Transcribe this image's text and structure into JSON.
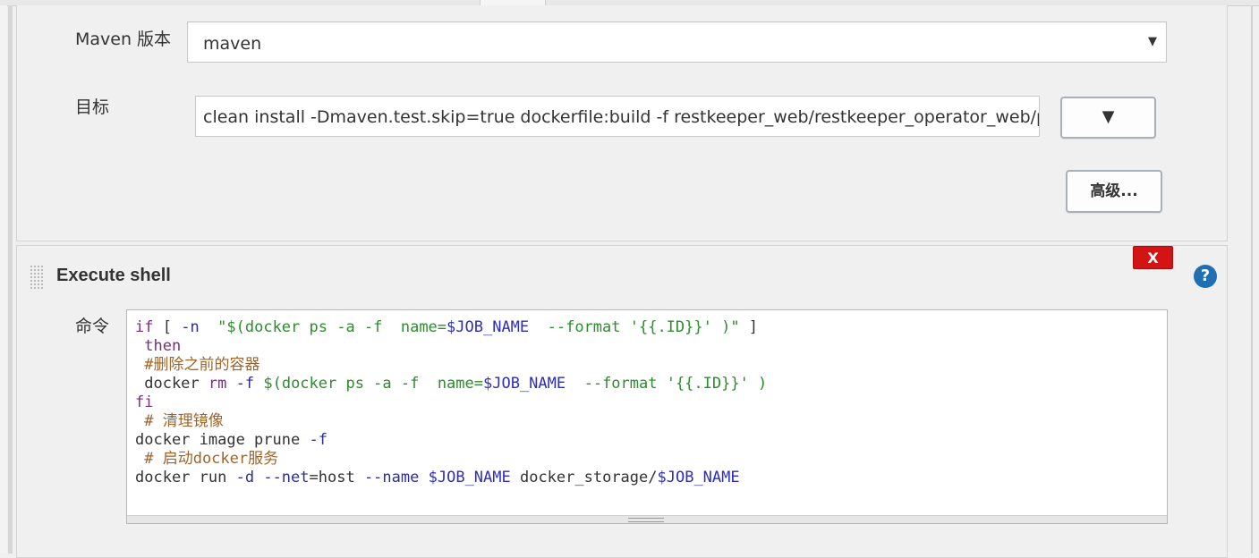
{
  "maven": {
    "version_label": "Maven 版本",
    "version_value": "maven",
    "goals_label": "目标",
    "goals_value": "clean install -Dmaven.test.skip=true dockerfile:build -f restkeeper_web/restkeeper_operator_web/pom.xml",
    "expand_glyph": "▼",
    "advanced_label": "高级..."
  },
  "shell": {
    "title": "Execute shell",
    "delete_label": "X",
    "help_glyph": "?",
    "command_label": "命令",
    "lines": [
      [
        {
          "t": "if",
          "c": "kw"
        },
        {
          "t": " [ ",
          "c": ""
        },
        {
          "t": "-n",
          "c": "opt"
        },
        {
          "t": "  \"$(docker ps -a -f  name=",
          "c": "str"
        },
        {
          "t": "$JOB_NAME",
          "c": "var"
        },
        {
          "t": "  --format '{{.ID}}' )\"",
          "c": "str"
        },
        {
          "t": " ]",
          "c": ""
        }
      ],
      [
        {
          "t": " then",
          "c": "kw"
        }
      ],
      [
        {
          "t": " #删除之前的容器",
          "c": "com"
        }
      ],
      [
        {
          "t": " docker ",
          "c": ""
        },
        {
          "t": "rm",
          "c": "kw"
        },
        {
          "t": " ",
          "c": ""
        },
        {
          "t": "-f",
          "c": "opt"
        },
        {
          "t": " ",
          "c": ""
        },
        {
          "t": "$(docker ps -a -f  name=",
          "c": "str"
        },
        {
          "t": "$JOB_NAME",
          "c": "var"
        },
        {
          "t": "  --format '{{.ID}}' )",
          "c": "str"
        }
      ],
      [
        {
          "t": "fi",
          "c": "kw"
        }
      ],
      [
        {
          "t": " # 清理镜像",
          "c": "com"
        }
      ],
      [
        {
          "t": "docker image prune ",
          "c": ""
        },
        {
          "t": "-f",
          "c": "opt"
        }
      ],
      [
        {
          "t": " # 启动docker服务",
          "c": "com"
        }
      ],
      [
        {
          "t": "docker run ",
          "c": ""
        },
        {
          "t": "-d",
          "c": "opt"
        },
        {
          "t": " ",
          "c": ""
        },
        {
          "t": "--net",
          "c": "opt"
        },
        {
          "t": "=host ",
          "c": ""
        },
        {
          "t": "--name",
          "c": "opt"
        },
        {
          "t": " ",
          "c": ""
        },
        {
          "t": "$JOB_NAME",
          "c": "var"
        },
        {
          "t": " docker_storage/",
          "c": ""
        },
        {
          "t": "$JOB_NAME",
          "c": "var"
        }
      ]
    ]
  },
  "colors": {
    "delete_button": "#d21414",
    "help_icon": "#1f6fb2",
    "code_keyword": "#7a2f7a",
    "code_string": "#2e8b2e",
    "code_variable": "#2d2dbf",
    "code_comment": "#a0642a"
  }
}
